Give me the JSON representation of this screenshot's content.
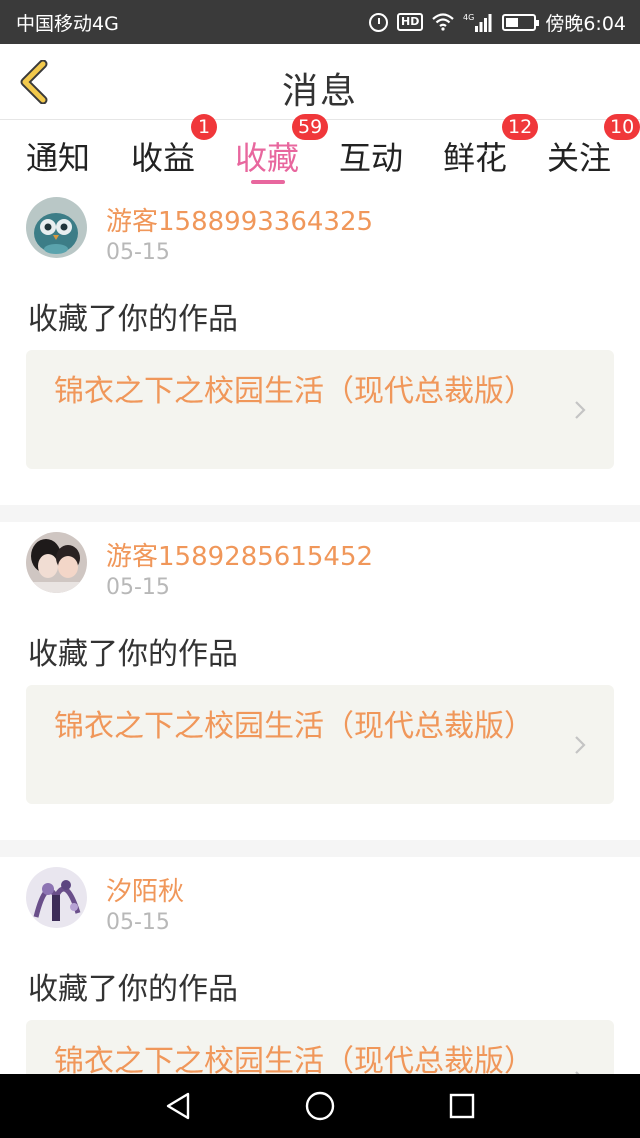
{
  "status_bar": {
    "carrier": "中国移动4G",
    "time": "傍晚6:04",
    "hd_label": "HD",
    "battery_level": 0.45,
    "icons": [
      "alarm-icon",
      "hd-icon",
      "wifi-icon",
      "signal-icon",
      "battery-icon"
    ]
  },
  "header": {
    "title": "消息",
    "back_icon": "chevron-left-icon"
  },
  "tabs": [
    {
      "label": "通知",
      "badge": ""
    },
    {
      "label": "收益",
      "badge": "1"
    },
    {
      "label": "收藏",
      "badge": "59",
      "active": true
    },
    {
      "label": "互动",
      "badge": ""
    },
    {
      "label": "鲜花",
      "badge": "12"
    },
    {
      "label": "关注",
      "badge": "10"
    }
  ],
  "feed": {
    "items": [
      {
        "username": "游客1588993364325",
        "date": "05-15",
        "action": "收藏了你的作品",
        "work_title": "锦衣之下之校园生活（现代总裁版）"
      },
      {
        "username": "游客1589285615452",
        "date": "05-15",
        "action": "收藏了你的作品",
        "work_title": "锦衣之下之校园生活（现代总裁版）"
      },
      {
        "username": "汐陌秋",
        "date": "05-15",
        "action": "收藏了你的作品",
        "work_title": "锦衣之下之校园生活（现代总裁版）"
      }
    ]
  },
  "colors": {
    "accent_pink": "#e8679e",
    "name_orange": "#f0975a",
    "badge_red": "#f0373a",
    "back_arrow": "#f2c94c"
  },
  "nav_bar": {
    "icons": [
      "back-triangle-icon",
      "home-circle-icon",
      "recents-square-icon"
    ]
  }
}
